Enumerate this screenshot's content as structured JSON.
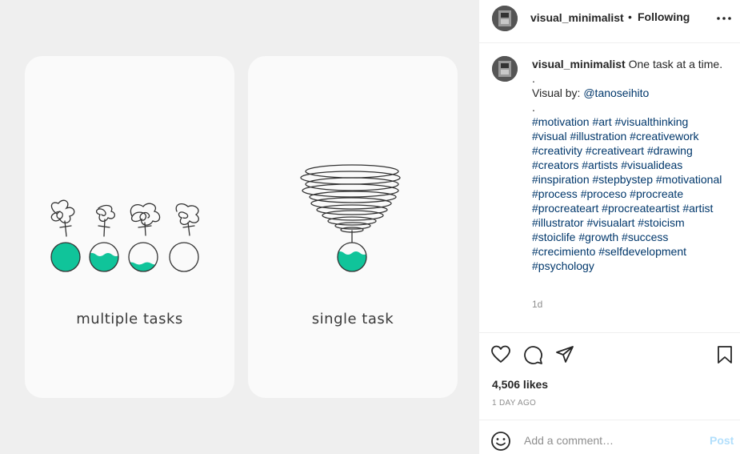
{
  "post": {
    "username": "visual_minimalist",
    "follow_status": "Following",
    "left_card_caption": "multiple tasks",
    "right_card_caption": "single task",
    "caption": {
      "username": "visual_minimalist",
      "text": "One task at a time.",
      "dot1": ".",
      "visual_by_label": "Visual by: ",
      "visual_by_handle": "@tanoseihito",
      "dot2": ".",
      "hashtags": [
        "#motivation #art #visualthinking",
        "#visual #illustration #creativework",
        "#creativity #creativeart #drawing",
        "#creators #artists #visualideas",
        "#inspiration #stepbystep #motivational",
        "#process #proceso #procreate",
        "#procreateart #procreateartist #artist",
        "#illustrator #visualart #stoicism",
        "#stoiclife #growth #success",
        "#crecimiento #selfdevelopment",
        "#psychology"
      ],
      "age": "1d"
    },
    "likes": "4,506 likes",
    "timestamp": "1 DAY AGO"
  },
  "comment": {
    "placeholder": "Add a comment…",
    "post_label": "Post"
  },
  "icons": {
    "more": "more-options-icon",
    "like": "heart-icon",
    "comment": "comment-icon",
    "share": "share-icon",
    "save": "bookmark-icon",
    "emoji": "emoji-icon"
  },
  "colors": {
    "accent_teal": "#10c49a",
    "link": "#00376b",
    "post_disabled": "#b2dffc"
  }
}
